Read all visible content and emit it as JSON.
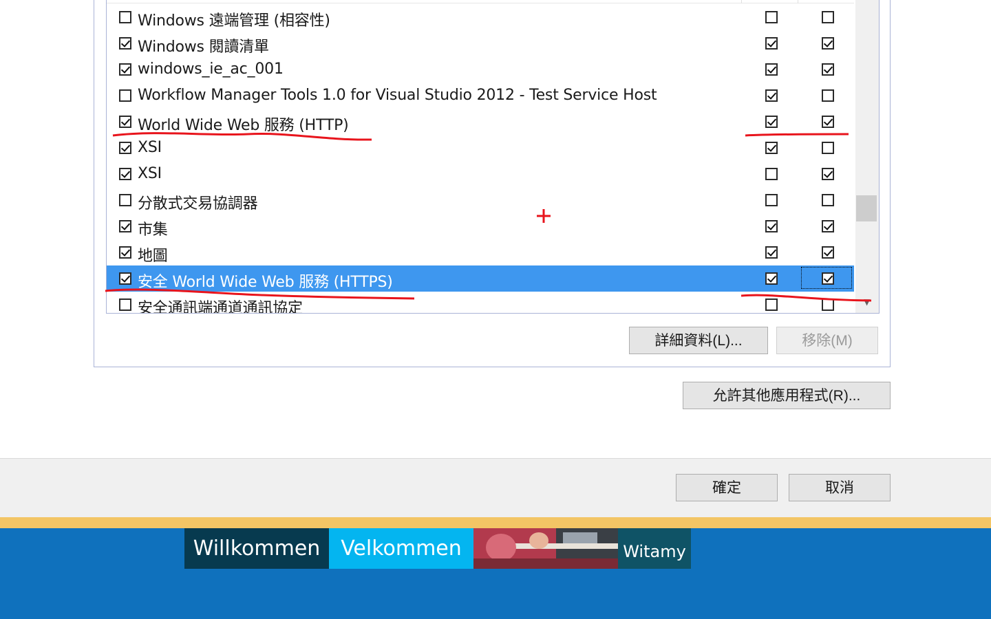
{
  "services": [
    {
      "name": "Windows 遠端管理 (相容性)",
      "enabled": false,
      "col1": false,
      "col2": false
    },
    {
      "name": "Windows 閱讀清單",
      "enabled": true,
      "col1": true,
      "col2": true
    },
    {
      "name": "windows_ie_ac_001",
      "enabled": true,
      "col1": true,
      "col2": true
    },
    {
      "name": "Workflow Manager Tools 1.0 for Visual Studio 2012 - Test Service Host",
      "enabled": false,
      "col1": true,
      "col2": false
    },
    {
      "name": "World Wide Web 服務 (HTTP)",
      "enabled": true,
      "col1": true,
      "col2": true
    },
    {
      "name": "XSI",
      "enabled": true,
      "col1": true,
      "col2": false
    },
    {
      "name": "XSI",
      "enabled": true,
      "col1": false,
      "col2": true
    },
    {
      "name": "分散式交易協調器",
      "enabled": false,
      "col1": false,
      "col2": false
    },
    {
      "name": "市集",
      "enabled": true,
      "col1": true,
      "col2": true
    },
    {
      "name": "地圖",
      "enabled": true,
      "col1": true,
      "col2": true
    },
    {
      "name": "安全 World Wide Web 服務 (HTTPS)",
      "enabled": true,
      "col1": true,
      "col2": true,
      "selected": true
    },
    {
      "name": "安全通訊端通道通訊協定",
      "enabled": false,
      "col1": false,
      "col2": false
    }
  ],
  "buttons": {
    "details": "詳細資料(L)...",
    "remove": "移除(M)",
    "allow_other": "允許其他應用程式(R)...",
    "ok": "確定",
    "cancel": "取消"
  },
  "banner": {
    "tile1": "Willkommen",
    "tile2": "Velkommen",
    "tile4": "Witamy"
  },
  "colors": {
    "selection": "#3e97ef",
    "annotation": "#e8141c",
    "banner_blue": "#0f71bd",
    "gold": "#f3c565"
  }
}
